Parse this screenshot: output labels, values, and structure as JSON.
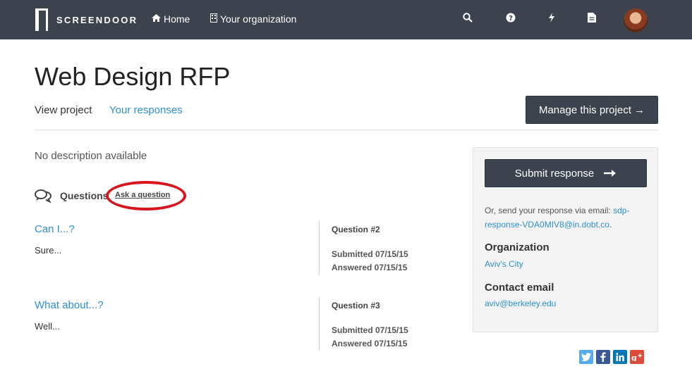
{
  "nav": {
    "brand": "SCREENDOOR",
    "home_label": "Home",
    "org_label": "Your organization",
    "icons": [
      "search-icon",
      "help-icon",
      "bolt-icon",
      "document-icon"
    ]
  },
  "header": {
    "title": "Web Design RFP",
    "tab_view": "View project",
    "tab_responses": "Your responses",
    "manage_label": "Manage this project →"
  },
  "main": {
    "description": "No description available",
    "questions_label": "Questions",
    "ask_label": "Ask a question",
    "questions": [
      {
        "title": "Can I...?",
        "answer": "Sure...",
        "number": "Question #2",
        "submitted": "Submitted 07/15/15",
        "answered": "Answered 07/15/15"
      },
      {
        "title": "What about...?",
        "answer": "Well...",
        "number": "Question #3",
        "submitted": "Submitted 07/15/15",
        "answered": "Answered 07/15/15"
      }
    ]
  },
  "sidebar": {
    "submit_label": "Submit response",
    "email_prefix": "Or, send your response via email:",
    "email_address": "sdp-response-VDA0MIV8@in.dobt.co",
    "email_suffix": ".",
    "org_heading": "Organization",
    "org_value": "Aviv's City",
    "contact_heading": "Contact email",
    "contact_value": "aviv@berkeley.edu"
  },
  "social": {
    "icons": [
      "twitter-icon",
      "facebook-icon",
      "linkedin-icon",
      "googleplus-icon"
    ],
    "colors": {
      "twitter": "#55acee",
      "facebook": "#3b5998",
      "linkedin": "#0077b5",
      "googleplus": "#dd4b39"
    }
  },
  "colors": {
    "nav_bg": "#3c434e",
    "link": "#2c8fd0",
    "highlight": "#d9141c"
  }
}
